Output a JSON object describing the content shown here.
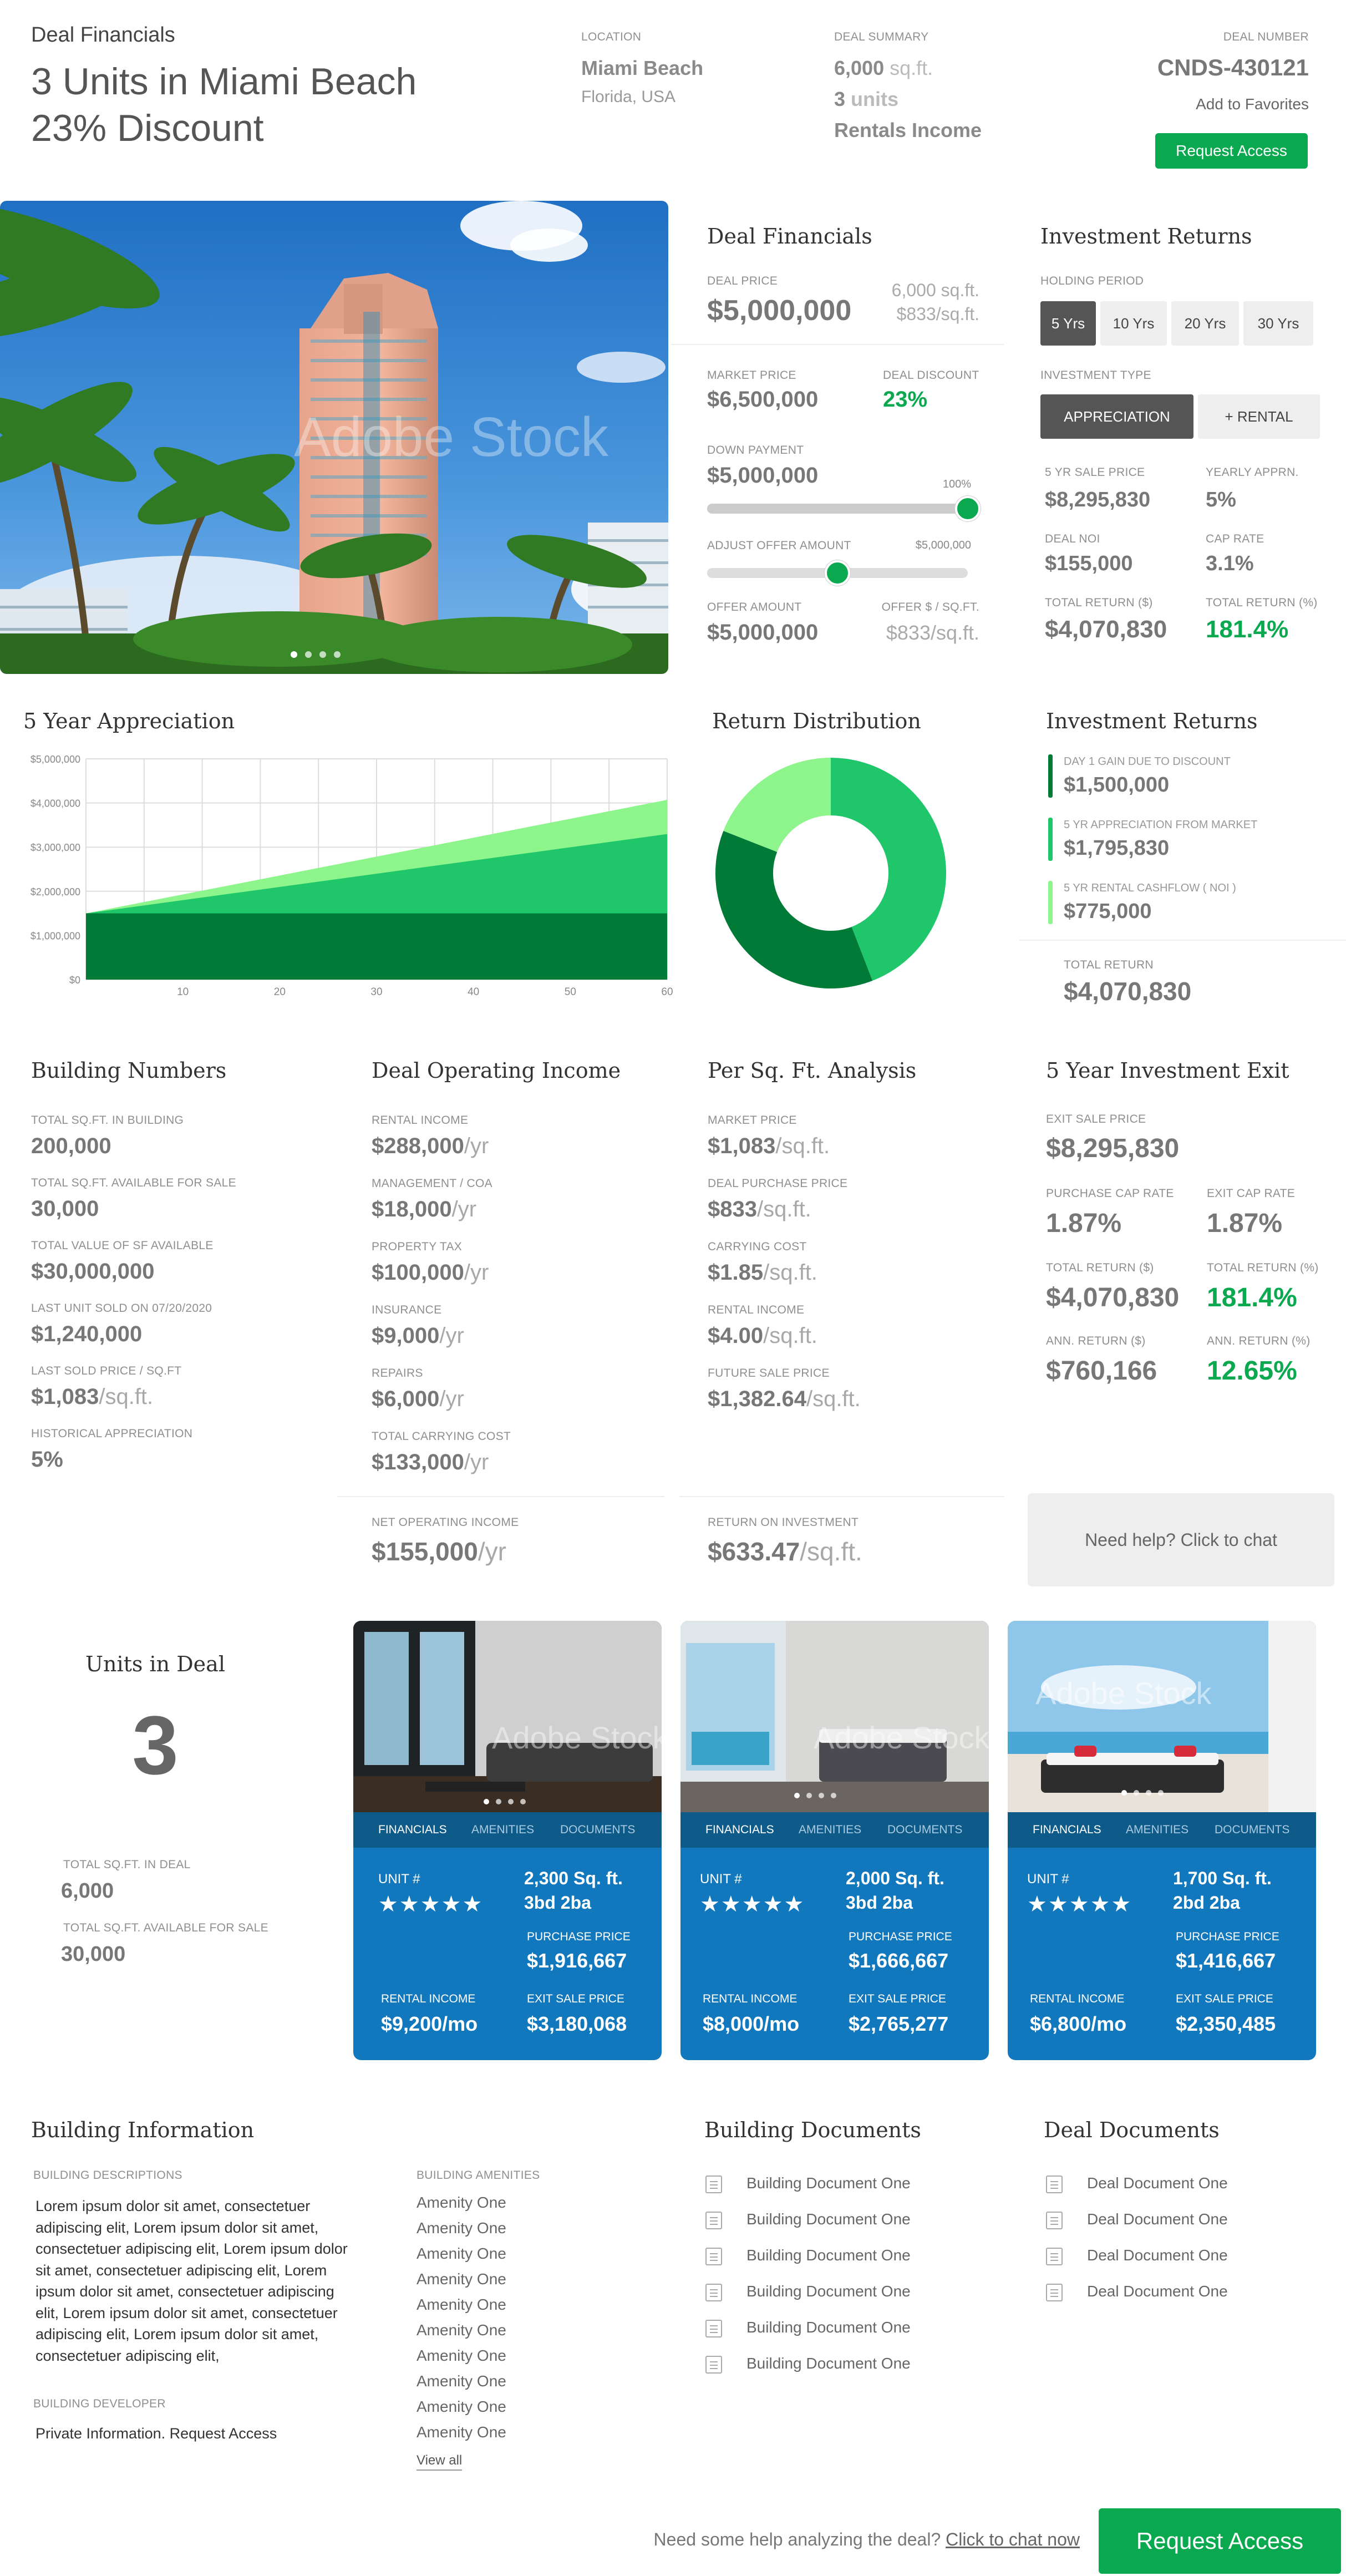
{
  "header": {
    "small_title": "Deal Financials",
    "title_line1": "3 Units in Miami Beach",
    "title_line2": "23% Discount",
    "location_label": "LOCATION",
    "location_city": "Miami Beach",
    "location_state": "Florida, USA",
    "summary_label": "DEAL SUMMARY",
    "summary_sqft_num": "6,000",
    "summary_sqft_unit": "sq.ft.",
    "summary_units_num": "3",
    "summary_units_unit": "units",
    "summary_rental": "Rentals Income",
    "deal_number_label": "DEAL NUMBER",
    "deal_number": "CNDS-430121",
    "favorites": "Add to Favorites",
    "request_access": "Request Access"
  },
  "hero": {
    "watermark": "Adobe Stock"
  },
  "deal_financials": {
    "title": "Deal Financials",
    "deal_price_label": "DEAL PRICE",
    "deal_price": "$5,000,000",
    "deal_sqft": "6,000 sq.ft.",
    "deal_per_sqft": "$833/sq.ft.",
    "market_price_label": "MARKET PRICE",
    "market_price": "$6,500,000",
    "discount_label": "DEAL DISCOUNT",
    "discount": "23%",
    "down_label": "DOWN PAYMENT",
    "down_value": "$5,000,000",
    "down_pct": "100%",
    "down_fraction": 1.0,
    "adjust_label": "ADJUST OFFER AMOUNT",
    "adjust_max": "$5,000,000",
    "adjust_fraction": 0.5,
    "offer_label": "OFFER AMOUNT",
    "offer_value": "$5,000,000",
    "offer_sqft_label": "OFFER $ / SQ.FT.",
    "offer_sqft": "$833/sq.ft."
  },
  "investment_returns": {
    "title": "Investment Returns",
    "holding_label": "HOLDING PERIOD",
    "holding_tabs": [
      "5 Yrs",
      "10 Yrs",
      "20 Yrs",
      "30 Yrs"
    ],
    "type_label": "INVESTMENT TYPE",
    "type_tabs": [
      "APPRECIATION",
      "+ RENTAL"
    ],
    "sale_label": "5 YR SALE PRICE",
    "sale": "$8,295,830",
    "yearly_label": "YEARLY APPRN.",
    "yearly": "5%",
    "noi_label": "DEAL NOI",
    "noi": "$155,000",
    "cap_label": "CAP RATE",
    "cap": "3.1%",
    "tr_label": "TOTAL RETURN ($)",
    "tr": "$4,070,830",
    "trp_label": "TOTAL RETURN (%)",
    "trp": "181.4%"
  },
  "appreciation": {
    "title": "5 Year Appreciation"
  },
  "distribution": {
    "title": "Return Distribution"
  },
  "returns_breakdown": {
    "title": "Investment Returns",
    "items": [
      {
        "label": "DAY 1 GAIN DUE TO DISCOUNT",
        "value": "$1,500,000",
        "color": "#007a37"
      },
      {
        "label": "5 YR APPRECIATION FROM MARKET",
        "value": "$1,795,830",
        "color": "#1fc66a"
      },
      {
        "label": "5 YR RENTAL CASHFLOW ( NOI )",
        "value": "$775,000",
        "color": "#8ef58d"
      }
    ],
    "total_label": "TOTAL RETURN",
    "total": "$4,070,830"
  },
  "chart_data": [
    {
      "type": "area",
      "title": "5 Year Appreciation",
      "x": [
        0,
        60
      ],
      "xticks": [
        "10",
        "20",
        "30",
        "40",
        "50",
        "60"
      ],
      "yticks": [
        "$0",
        "$1,000,000",
        "$2,000,000",
        "$3,000,000",
        "$4,000,000",
        "$5,000,000"
      ],
      "ylim": [
        0,
        5000000
      ],
      "grid": true,
      "series": [
        {
          "values": [
            1500000,
            1500000
          ],
          "color": "#007a37"
        },
        {
          "values": [
            1500000,
            3295830
          ],
          "color": "#1fc66a"
        },
        {
          "values": [
            1500000,
            4070830
          ],
          "color": "#8ef58d"
        }
      ]
    },
    {
      "type": "pie",
      "title": "Return Distribution",
      "values": [
        1500000,
        1795830,
        775000
      ],
      "colors": [
        "#007a37",
        "#1fc66a",
        "#8ef58d"
      ],
      "donut": true
    }
  ],
  "building_numbers": {
    "title": "Building Numbers",
    "items": [
      {
        "label": "TOTAL SQ.FT. IN BUILDING",
        "value": "200,000",
        "unit": ""
      },
      {
        "label": "TOTAL SQ.FT. AVAILABLE FOR SALE",
        "value": "30,000",
        "unit": ""
      },
      {
        "label": "TOTAL VALUE OF SF AVAILABLE",
        "value": "$30,000,000",
        "unit": ""
      },
      {
        "label": "LAST UNIT SOLD ON 07/20/2020",
        "value": "$1,240,000",
        "unit": ""
      },
      {
        "label": "LAST SOLD PRICE / SQ.FT",
        "value": "$1,083",
        "unit": "/sq.ft."
      },
      {
        "label": "HISTORICAL APPRECIATION",
        "value": "5%",
        "unit": ""
      }
    ]
  },
  "operating_income": {
    "title": "Deal Operating Income",
    "items": [
      {
        "label": "RENTAL INCOME",
        "value": "$288,000",
        "unit": "/yr"
      },
      {
        "label": "MANAGEMENT / COA",
        "value": "$18,000",
        "unit": "/yr"
      },
      {
        "label": "PROPERTY TAX",
        "value": "$100,000",
        "unit": "/yr"
      },
      {
        "label": "INSURANCE",
        "value": "$9,000",
        "unit": "/yr"
      },
      {
        "label": "REPAIRS",
        "value": "$6,000",
        "unit": "/yr"
      },
      {
        "label": "TOTAL CARRYING COST",
        "value": "$133,000",
        "unit": "/yr"
      }
    ],
    "noi_label": "NET OPERATING INCOME",
    "noi": "$155,000",
    "noi_unit": "/yr"
  },
  "per_sqft": {
    "title": "Per Sq. Ft. Analysis",
    "items": [
      {
        "label": "MARKET PRICE",
        "value": "$1,083",
        "unit": "/sq.ft."
      },
      {
        "label": "DEAL PURCHASE PRICE",
        "value": "$833",
        "unit": "/sq.ft."
      },
      {
        "label": "CARRYING COST",
        "value": "$1.85",
        "unit": "/sq.ft."
      },
      {
        "label": "RENTAL INCOME",
        "value": "$4.00",
        "unit": "/sq.ft."
      },
      {
        "label": "FUTURE SALE PRICE",
        "value": "$1,382.64",
        "unit": "/sq.ft."
      }
    ],
    "roi_label": "RETURN ON INVESTMENT",
    "roi": "$633.47",
    "roi_unit": "/sq.ft."
  },
  "exit": {
    "title": "5 Year Investment Exit",
    "sale_label": "EXIT SALE PRICE",
    "sale": "$8,295,830",
    "pcap_label": "PURCHASE CAP RATE",
    "pcap": "1.87%",
    "ecap_label": "EXIT CAP RATE",
    "ecap": "1.87%",
    "tr_label": "TOTAL RETURN ($)",
    "tr": "$4,070,830",
    "trp_label": "TOTAL RETURN (%)",
    "trp": "181.4%",
    "ar_label": "ANN. RETURN ($)",
    "ar": "$760,166",
    "arp_label": "ANN. RETURN (%)",
    "arp": "12.65%"
  },
  "help": {
    "chat": "Need help? Click to chat"
  },
  "units": {
    "title": "Units in Deal",
    "count": "3",
    "sqft_label": "TOTAL SQ.FT. IN DEAL",
    "sqft": "6,000",
    "avail_label": "TOTAL SQ.FT. AVAILABLE FOR SALE",
    "avail": "30,000",
    "tabs": [
      "FINANCIALS",
      "AMENITIES",
      "DOCUMENTS"
    ],
    "unit_label": "UNIT #",
    "stars": "★★★★★",
    "purchase_label": "PURCHASE PRICE",
    "rental_label": "RENTAL INCOME",
    "exit_label": "EXIT SALE PRICE",
    "cards": [
      {
        "sqft": "2,300 Sq. ft.",
        "beds": "3bd 2ba",
        "purchase": "$1,916,667",
        "rental": "$9,200/mo",
        "exit": "$3,180,068",
        "watermark": "Adobe Stock"
      },
      {
        "sqft": "2,000 Sq. ft.",
        "beds": "3bd 2ba",
        "purchase": "$1,666,667",
        "rental": "$8,000/mo",
        "exit": "$2,765,277",
        "watermark": "Adobe Stock"
      },
      {
        "sqft": "1,700 Sq. ft.",
        "beds": "2bd 2ba",
        "purchase": "$1,416,667",
        "rental": "$6,800/mo",
        "exit": "$2,350,485",
        "watermark": "Adobe Stock"
      }
    ]
  },
  "building_info": {
    "title": "Building Information",
    "desc_label": "BUILDING DESCRIPTIONS",
    "desc_lines": [
      "Lorem ipsum dolor sit amet, consectetuer",
      "adipiscing elit, Lorem ipsum dolor sit amet,",
      "consectetuer adipiscing elit, Lorem ipsum dolor",
      "sit amet, consectetuer adipiscing elit, Lorem",
      "ipsum dolor sit amet, consectetuer adipiscing",
      "elit, Lorem ipsum dolor sit amet, consectetuer",
      "adipiscing elit, Lorem ipsum dolor sit amet,",
      "consectetuer adipiscing elit,"
    ],
    "dev_label": "BUILDING DEVELOPER",
    "dev": "Private Information. Request Access",
    "amen_label": "BUILDING AMENITIES",
    "amenities": [
      "Amenity One",
      "Amenity One",
      "Amenity One",
      "Amenity One",
      "Amenity One",
      "Amenity One",
      "Amenity One",
      "Amenity One",
      "Amenity One",
      "Amenity One"
    ],
    "view_all": "View all"
  },
  "building_docs": {
    "title": "Building Documents",
    "items": [
      "Building Document One",
      "Building Document One",
      "Building Document One",
      "Building Document One",
      "Building Document One",
      "Building Document One"
    ]
  },
  "deal_docs": {
    "title": "Deal Documents",
    "items": [
      "Deal Document One",
      "Deal Document One",
      "Deal Document One",
      "Deal Document One"
    ]
  },
  "footer": {
    "text": "Need some help analyzing the deal?",
    "link": "Click to chat now",
    "button": "Request Access"
  }
}
